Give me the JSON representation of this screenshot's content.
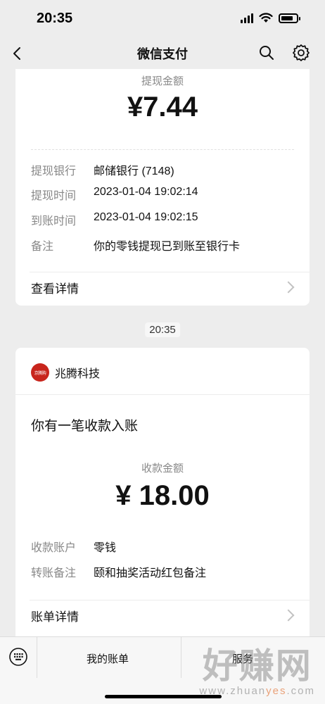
{
  "status_bar": {
    "time": "20:35"
  },
  "nav": {
    "title": "微信支付",
    "back_icon": "chevron-left-icon",
    "search_icon": "search-icon",
    "settings_icon": "gear-icon"
  },
  "withdrawal_card": {
    "amount_label": "提现金额",
    "amount": "¥7.44",
    "rows": [
      {
        "key": "提现银行",
        "value": "邮储银行 (7148)"
      },
      {
        "key": "提现时间",
        "value": "2023-01-04 19:02:14"
      },
      {
        "key": "到账时间",
        "value": "2023-01-04 19:02:15"
      },
      {
        "key": "备注",
        "value": "你的零钱提现已到账至银行卡"
      }
    ],
    "detail_link": "查看详情"
  },
  "timestamp": "20:35",
  "receipt_card": {
    "merchant_logo_text": "京腾购",
    "merchant_name": "兆腾科技",
    "notice": "你有一笔收款入账",
    "amount_label": "收款金额",
    "amount": "¥ 18.00",
    "rows": [
      {
        "key": "收款账户",
        "value": "零钱"
      },
      {
        "key": "转账备注",
        "value": "颐和抽奖活动红包备注"
      }
    ],
    "detail_link": "账单详情"
  },
  "bottom_bar": {
    "keyboard_icon": "keyboard-icon",
    "my_bills": "我的账单",
    "services": "服务"
  },
  "watermark": {
    "main": "好赚网",
    "sub_prefix": "www.zhuan",
    "sub_highlight": "yes",
    "sub_suffix": ".com"
  }
}
